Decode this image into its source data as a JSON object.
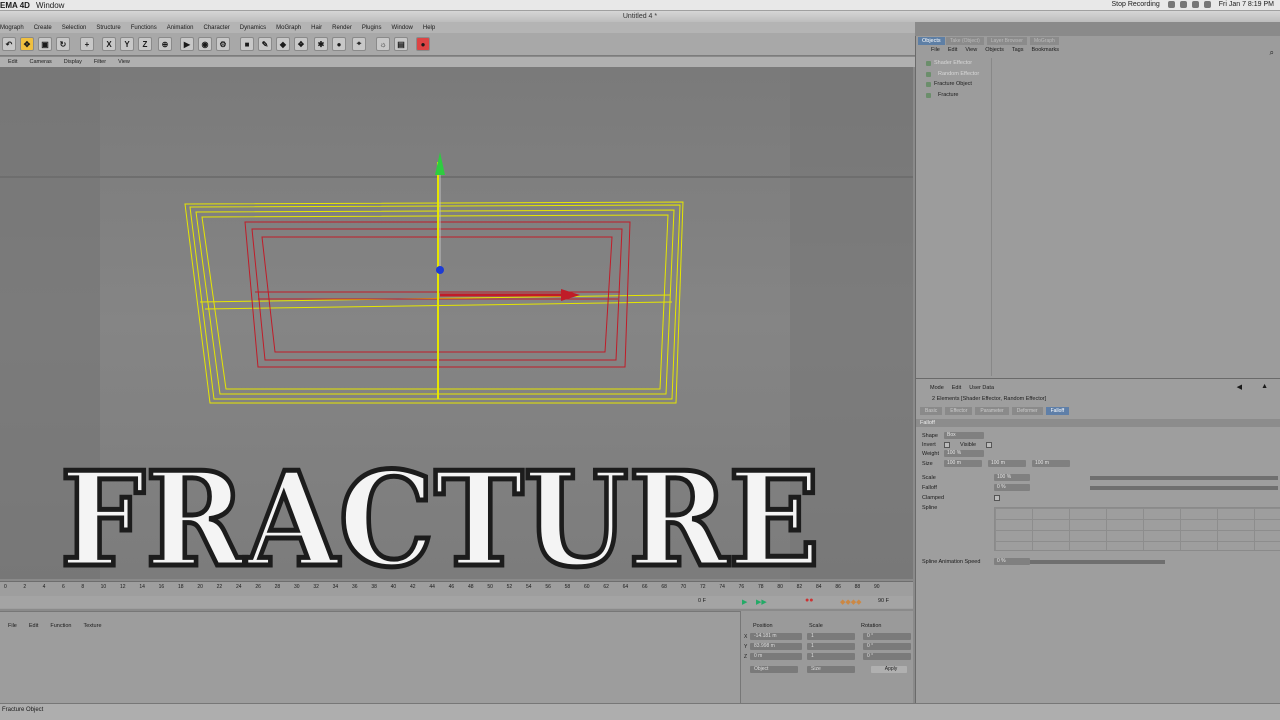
{
  "mac_menubar": {
    "app_name": "EMA 4D",
    "window_menu": "Window",
    "recording": "Stop Recording",
    "clock": "Fri Jan 7  8:19 PM"
  },
  "window_title": "Untitled 4 *",
  "main_menu": [
    "Mograph",
    "Create",
    "Selection",
    "Structure",
    "Functions",
    "Animation",
    "Character",
    "Dynamics",
    "MoGraph",
    "Hair",
    "Render",
    "Plugins",
    "Window",
    "Help"
  ],
  "toolbar": {
    "axis_x": "X",
    "axis_y": "Y",
    "axis_z": "Z"
  },
  "viewport_menu": [
    "Edit",
    "Cameras",
    "Display",
    "Filter",
    "View"
  ],
  "viewport": {
    "overlay_text": "FRACTURE",
    "accent_yellow": "#e6e600",
    "accent_red": "#c01c28",
    "axis_green": "#2ecc40"
  },
  "timeline": {
    "ticks": [
      "0",
      "2",
      "4",
      "6",
      "8",
      "10",
      "12",
      "14",
      "16",
      "18",
      "20",
      "22",
      "24",
      "26",
      "28",
      "30",
      "32",
      "34",
      "36",
      "38",
      "40",
      "42",
      "44",
      "46",
      "48",
      "50",
      "52",
      "54",
      "56",
      "58",
      "60",
      "62",
      "64",
      "66",
      "68",
      "70",
      "72",
      "74",
      "76",
      "78",
      "80",
      "82",
      "84",
      "86",
      "88",
      "90"
    ],
    "frame_field": "0 F",
    "end_field": "90 F"
  },
  "material_menu": [
    "File",
    "Edit",
    "Function",
    "Texture"
  ],
  "coordinates": {
    "headers": [
      "Position",
      "Scale",
      "Rotation"
    ],
    "rows": [
      {
        "axis": "X",
        "position": "-14.181 m",
        "scale": "1",
        "rotation": "0 °"
      },
      {
        "axis": "Y",
        "position": "83.998 m",
        "scale": "1",
        "rotation": "0 °"
      },
      {
        "axis": "Z",
        "position": "0 m",
        "scale": "1",
        "rotation": "0 °"
      }
    ],
    "mode_object": "Object",
    "mode_size": "Size",
    "apply": "Apply"
  },
  "objects_panel": {
    "active_tab": "Objects",
    "tabs": [
      "Take (Object)",
      "Layer Browser",
      "MoGraph"
    ],
    "menu": [
      "File",
      "Edit",
      "View",
      "Objects",
      "Tags",
      "Bookmarks"
    ],
    "items": [
      {
        "label": "Shader Effector",
        "dim": true,
        "indent": false
      },
      {
        "label": "Random Effector",
        "dim": true,
        "indent": true
      },
      {
        "label": "Fracture Object",
        "dim": false,
        "indent": false
      },
      {
        "label": "Fracture",
        "dim": false,
        "indent": true
      }
    ]
  },
  "attributes_panel": {
    "menu": [
      "Mode",
      "Edit",
      "User Data"
    ],
    "title": "2 Elements [Shader Effector, Random Effector]",
    "tabs": [
      "Basic",
      "Effector",
      "Parameter",
      "Deformer",
      "Falloff"
    ],
    "active_tab": "Falloff",
    "section": "Falloff",
    "rows": [
      {
        "label": "Shape",
        "value": "Box"
      },
      {
        "label": "Invert",
        "value": ""
      },
      {
        "label": "Visible",
        "value": ""
      },
      {
        "label": "Weight",
        "value": "100 %"
      },
      {
        "label": "Size",
        "value": "100 m"
      },
      {
        "label": "Scale",
        "value": "100 %"
      },
      {
        "label": "Falloff",
        "value": "0 %"
      },
      {
        "label": "Clamped",
        "value": ""
      },
      {
        "label": "Spline",
        "value": ""
      },
      {
        "label": "Spline Animation Speed",
        "value": "0 %"
      }
    ],
    "size_extra": [
      "100 m",
      "100 m"
    ]
  },
  "status": "Fracture Object"
}
